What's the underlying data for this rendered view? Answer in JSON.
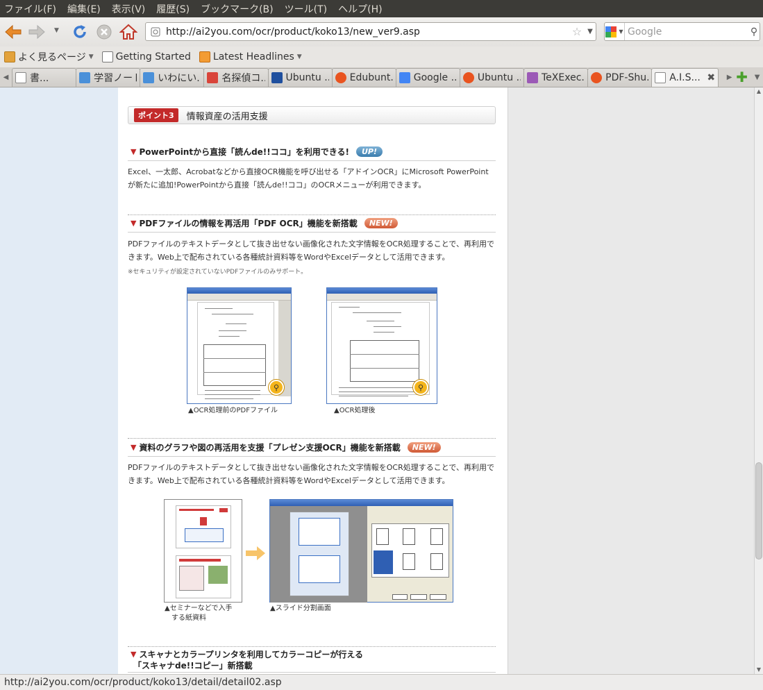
{
  "menu": [
    "ファイル(F)",
    "編集(E)",
    "表示(V)",
    "履歴(S)",
    "ブックマーク(B)",
    "ツール(T)",
    "ヘルプ(H)"
  ],
  "nav": {
    "url": "http://ai2you.com/ocr/product/koko13/new_ver9.asp",
    "search_placeholder": "Google"
  },
  "bookmarks": [
    {
      "label": "よく見るページ",
      "dropdown": true
    },
    {
      "label": "Getting Started",
      "dropdown": false
    },
    {
      "label": "Latest Headlines",
      "dropdown": true
    }
  ],
  "tabs": [
    {
      "label": "書..."
    },
    {
      "label": "学習ノート"
    },
    {
      "label": "いわにい..."
    },
    {
      "label": "名探偵コ..."
    },
    {
      "label": "Ubuntu ..."
    },
    {
      "label": "Edubunt..."
    },
    {
      "label": "Google ..."
    },
    {
      "label": "Ubuntu ..."
    },
    {
      "label": "TeXExec..."
    },
    {
      "label": "PDF-Shu..."
    },
    {
      "label": "A.I.S...",
      "active": true
    }
  ],
  "page": {
    "point_badge": "ポイント3",
    "point_title": "情報資産の活用支援",
    "sections": [
      {
        "title": "PowerPointから直接「読んde!!ココ」を利用できる!",
        "badge": "UP!",
        "text": "Excel、一太郎、Acrobatなどから直接OCR機能を呼び出せる「アドインOCR」にMicrosoft PowerPointが新たに追加!PowerPointから直接「読んde!!ココ」のOCRメニューが利用できます。"
      },
      {
        "title": "PDFファイルの情報を再活用「PDF OCR」機能を新搭載",
        "badge": "NEW!",
        "text": "PDFファイルのテキストデータとして抜き出せない画像化された文字情報をOCR処理することで、再利用できます。Web上で配布されている各種統計資料等をWordやExcelデータとして活用できます。",
        "note": "※セキュリティが設定されていないPDFファイルのみサポート。",
        "caption_left": "▲OCR処理前のPDFファイル",
        "caption_right": "▲OCR処理後"
      },
      {
        "title": "資料のグラフや図の再活用を支援「プレゼン支援OCR」機能を新搭載",
        "badge": "NEW!",
        "text": "PDFファイルのテキストデータとして抜き出せない画像化された文字情報をOCR処理することで、再利用できます。Web上で配布されている各種統計資料等をWordやExcelデータとして活用できます。",
        "caption_left_1": "▲セミナーなどで入手",
        "caption_left_2": "　する紙資料",
        "caption_right": "▲スライド分割画面"
      },
      {
        "title_1": "スキャナとカラープリンタを利用してカラーコピーが行える",
        "title_2": "「スキャナde!!コピー」新搭載"
      }
    ]
  },
  "status": "http://ai2you.com/ocr/product/koko13/detail/detail02.asp"
}
